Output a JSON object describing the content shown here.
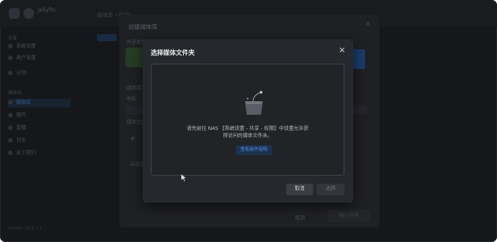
{
  "app": {
    "title": "Jellyfin"
  },
  "sidebar": {
    "sections": [
      "设置",
      "媒体库"
    ],
    "items": [
      {
        "label": "系统设置"
      },
      {
        "label": "用户设置"
      },
      {
        "label": "计划"
      },
      {
        "label": "媒体库"
      },
      {
        "label": "插件"
      },
      {
        "label": "直播"
      },
      {
        "label": "日志"
      },
      {
        "label": "关于我们"
      }
    ],
    "footer": "Jellyfin 10.8.13"
  },
  "main": {
    "title": "媒体库 › 创建"
  },
  "create_dialog": {
    "title": "创建媒体库",
    "content_type_label": "内容类型",
    "display_name_label": "媒体库名称",
    "select_value": "电影",
    "folders_label": "媒体文件夹",
    "advanced_label": "高级设置",
    "cancel_label": "取消",
    "ok_label": "确认创建"
  },
  "folder_dialog": {
    "title": "选择媒体文件夹",
    "message_line1": "请先前往 NAS 【系统设置 - 共享 - 权限】中设置允许获",
    "message_line2": "得访问的媒体文件夹。",
    "guide_button": "查看操作说明",
    "cancel_label": "取消",
    "ok_label": "选择"
  },
  "colors": {
    "accent": "#4d8fe0",
    "dialog_bg": "#26282d",
    "page_bg": "#1b1d21"
  }
}
